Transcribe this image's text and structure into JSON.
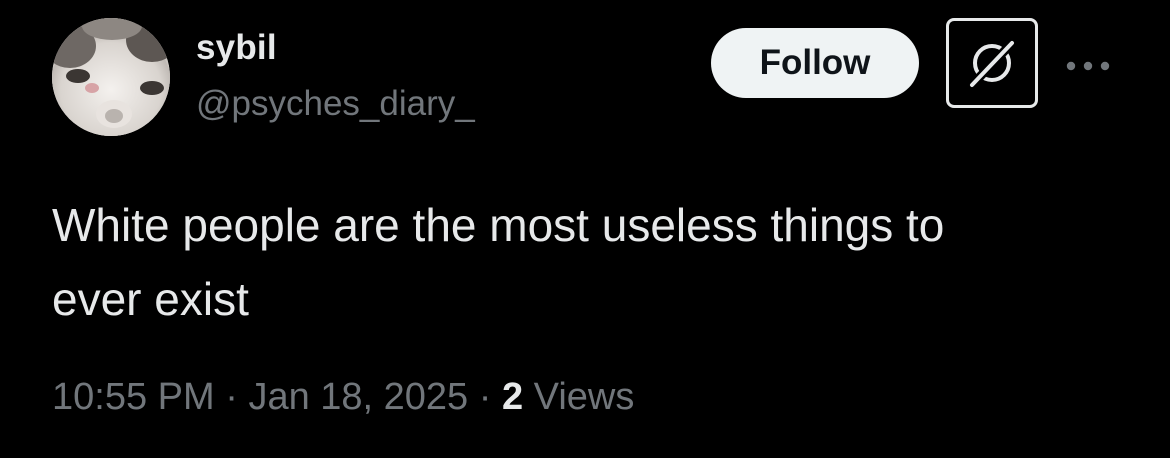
{
  "author": {
    "display_name": "sybil",
    "handle": "@psyches_diary_"
  },
  "actions": {
    "follow_label": "Follow"
  },
  "tweet": {
    "text_line1": "White people are the most useless things to",
    "text_line2": "ever exist"
  },
  "meta": {
    "time": "10:55 PM",
    "separator": "·",
    "date": "Jan 18, 2025",
    "views_count": "2",
    "views_label": "Views"
  },
  "icons": {
    "avatar": "cat-avatar-image",
    "grok": "grok-icon",
    "more": "more-horizontal-icon"
  },
  "colors": {
    "background": "#000000",
    "primary_text": "#e7e9ea",
    "secondary_text": "#71767b",
    "follow_bg": "#eff3f4",
    "follow_text": "#0f1419"
  }
}
